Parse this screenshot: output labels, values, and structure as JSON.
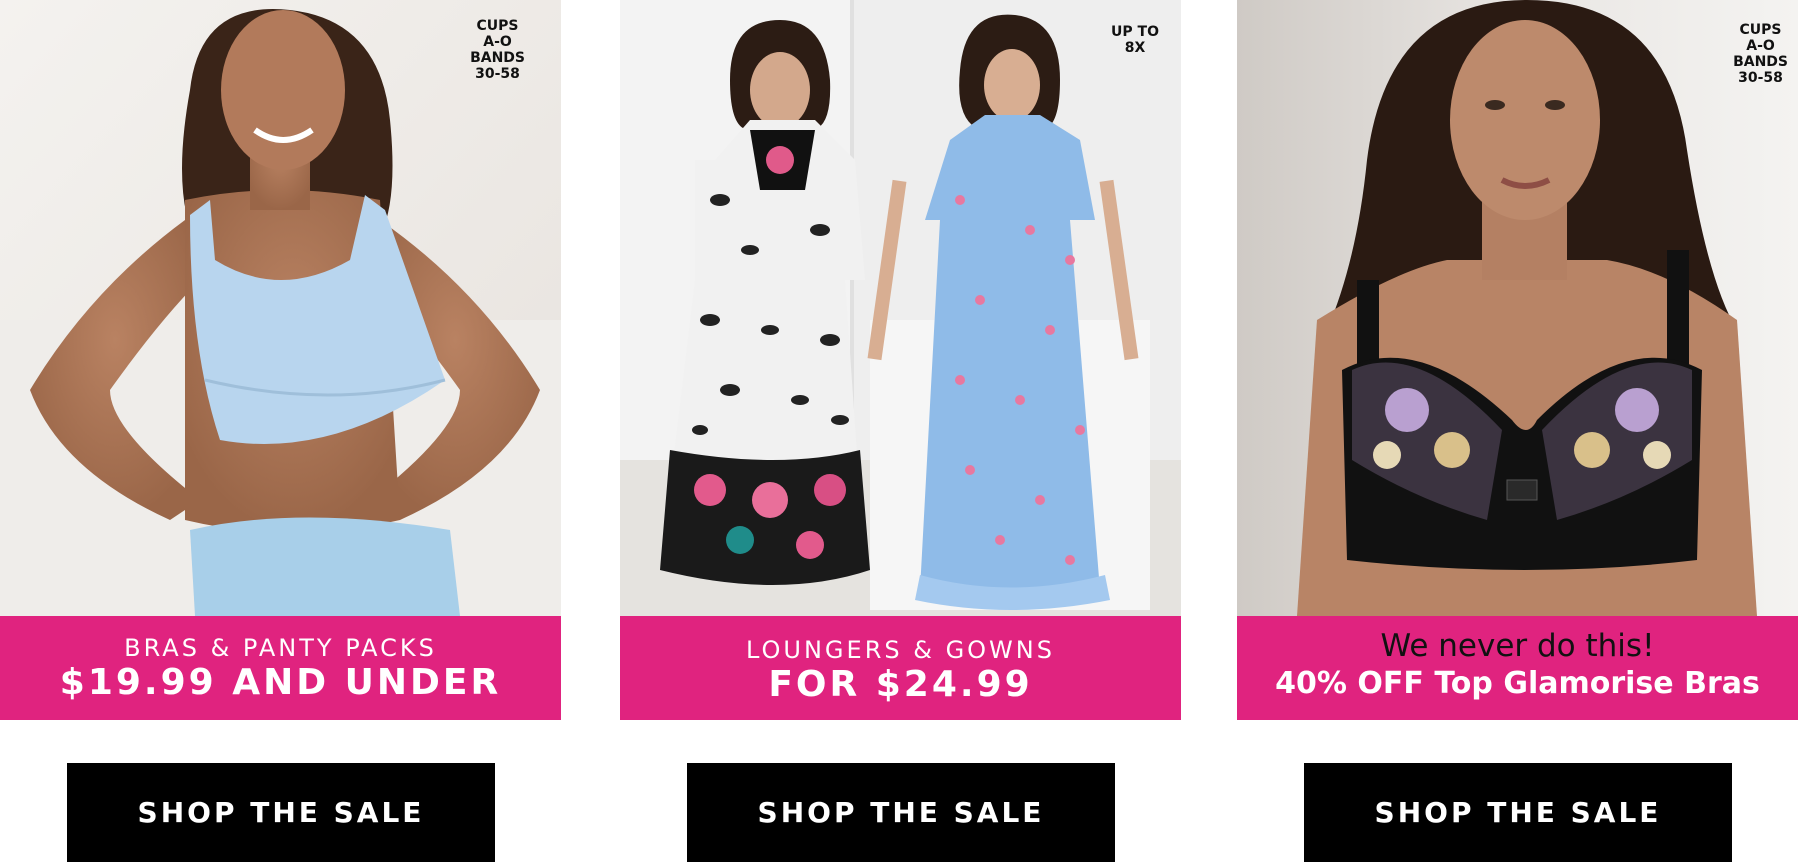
{
  "promos": [
    {
      "badge_lines": [
        "CUPS",
        "A-O",
        "BANDS",
        "30-58"
      ],
      "banner_line1": "BRAS & PANTY PACKS",
      "banner_line2": "$19.99 AND UNDER",
      "button_label": "SHOP THE SALE",
      "image_alt": "woman in light blue bra and panty"
    },
    {
      "badge_lines": [
        "UP TO",
        "8X"
      ],
      "banner_line1": "LOUNGERS & GOWNS",
      "banner_line2": "FOR $24.99",
      "button_label": "SHOP THE SALE",
      "image_alt": "two women in printed loungers and gowns"
    },
    {
      "badge_lines": [
        "CUPS",
        "A-O",
        "BANDS",
        "30-58"
      ],
      "banner_line1": "We never do this!",
      "banner_line2": "40% OFF Top Glamorise Bras",
      "button_label": "SHOP THE SALE",
      "image_alt": "woman in black floral lace bra"
    }
  ],
  "colors": {
    "banner_pink": "#e0237f",
    "button_black": "#000000",
    "text_white": "#ffffff"
  }
}
